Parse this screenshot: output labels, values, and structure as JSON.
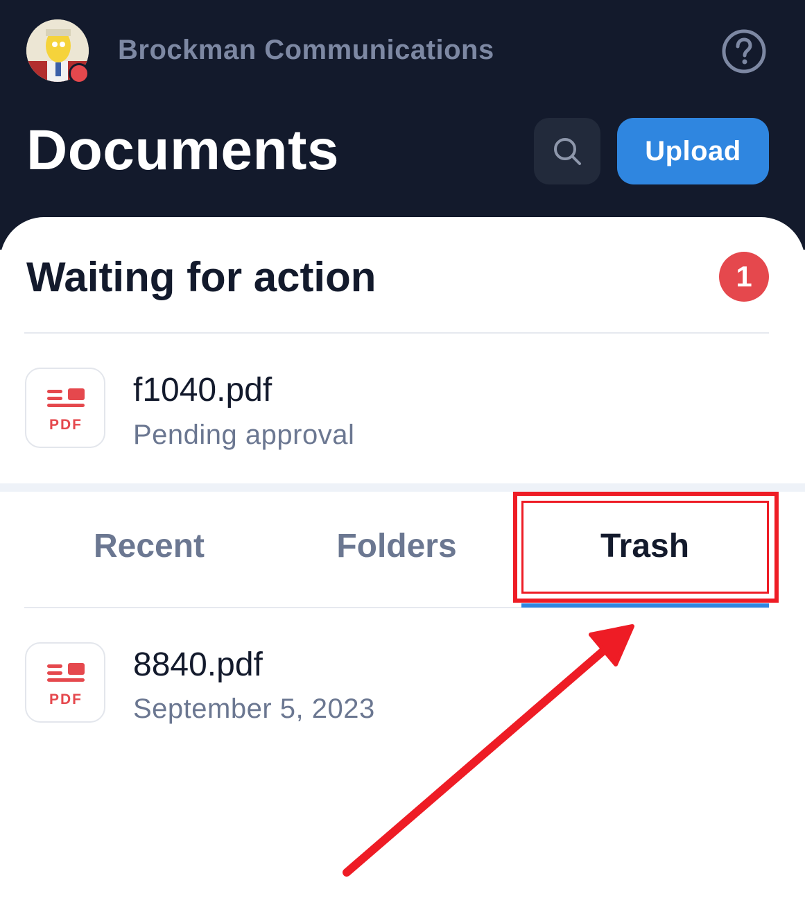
{
  "header": {
    "org_name": "Brockman Communications",
    "title": "Documents",
    "upload_label": "Upload",
    "avatar_icon": "user-avatar",
    "status_color": "#e5484d",
    "search_icon": "search-icon",
    "help_icon": "question-circle-icon"
  },
  "waiting": {
    "title": "Waiting for action",
    "count": "1",
    "items": [
      {
        "name": "f1040.pdf",
        "status": "Pending approval",
        "icon": "pdf-icon",
        "icon_label": "PDF"
      }
    ]
  },
  "tabs": [
    {
      "label": "Recent",
      "active": false
    },
    {
      "label": "Folders",
      "active": false
    },
    {
      "label": "Trash",
      "active": true
    }
  ],
  "files": [
    {
      "name": "8840.pdf",
      "date": "September 5, 2023",
      "icon": "pdf-icon",
      "icon_label": "PDF"
    }
  ],
  "colors": {
    "header_bg": "#131a2c",
    "accent": "#2f86e0",
    "badge": "#e5484d",
    "annotation": "#ee1c25"
  },
  "annotation": {
    "highlight_target": "Trash",
    "arrow_icon": "red-arrow-annotation"
  }
}
